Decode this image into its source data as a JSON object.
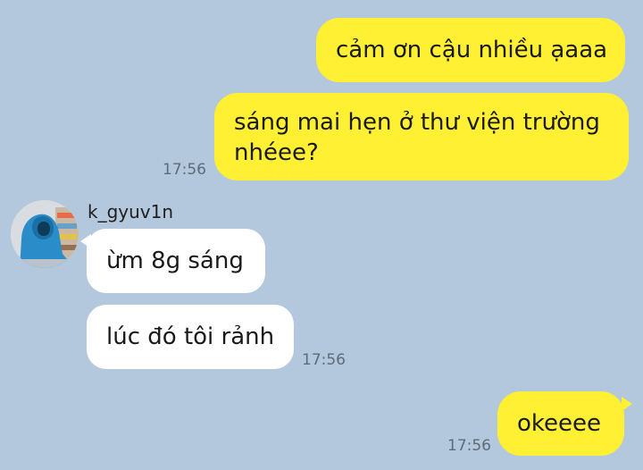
{
  "chat": {
    "messages": [
      {
        "text": "cảm ơn cậu nhiều ạaaa"
      },
      {
        "line1": "sáng mai hẹn ở thư viện trường",
        "line2": "nhéee?",
        "time": "17:56"
      },
      {
        "sender": "k_gyuv1n",
        "text": "ừm 8g sáng"
      },
      {
        "text": "lúc đó tôi rảnh",
        "time": "17:56"
      },
      {
        "text": "okeeee",
        "time": "17:56"
      }
    ]
  },
  "colors": {
    "background": "#b3c8dc",
    "outgoing_bubble": "#fff033",
    "incoming_bubble": "#ffffff",
    "timestamp": "#5f6b78"
  },
  "icons": {
    "avatar": "avatar-photo"
  }
}
